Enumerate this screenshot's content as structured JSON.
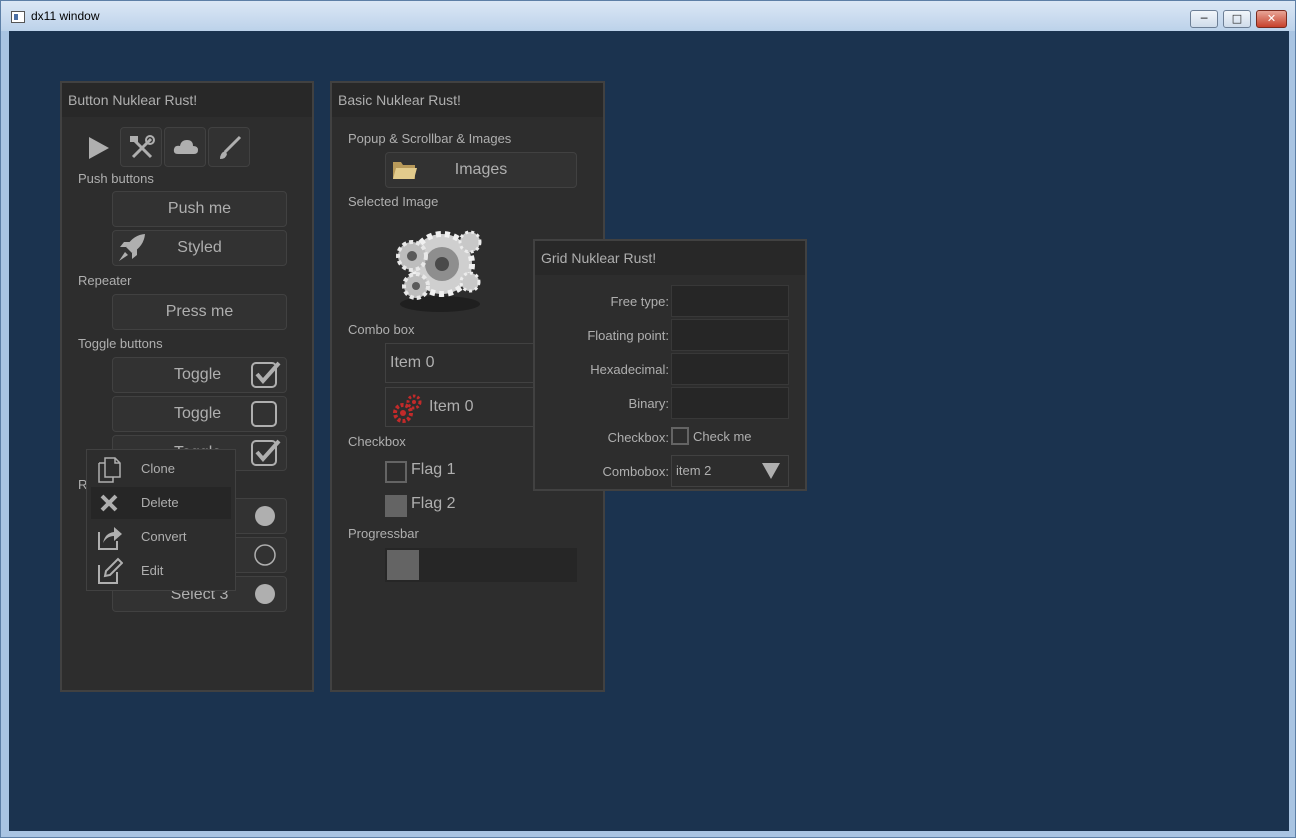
{
  "window": {
    "title": "dx11 window",
    "minimize": "─",
    "maximize": "□",
    "close": "✕"
  },
  "colors": {
    "desktop_bg": "#1b334f",
    "panel_bg": "#2d2d2d",
    "panel_header": "#282828",
    "text": "#afafaf",
    "gear_red": "#c22a2a"
  },
  "button_panel": {
    "title": "Button Nuklear Rust!",
    "icons": [
      "play-icon",
      "tools-icon",
      "cloud-icon",
      "brush-icon"
    ],
    "push_label": "Push buttons",
    "push_me": "Push me",
    "styled": "Styled",
    "repeater_label": "Repeater",
    "press_me": "Press me",
    "toggle_label": "Toggle buttons",
    "toggles": [
      {
        "label": "Toggle",
        "checked": true
      },
      {
        "label": "Toggle",
        "checked": false
      },
      {
        "label": "Toggle",
        "checked": true
      }
    ],
    "radio_label_partial": "R",
    "select_3": "Select 3"
  },
  "context_menu": {
    "items": [
      {
        "label": "Clone",
        "icon": "clone-icon"
      },
      {
        "label": "Delete",
        "icon": "delete-icon",
        "hovered": true
      },
      {
        "label": "Convert",
        "icon": "convert-icon"
      },
      {
        "label": "Edit",
        "icon": "edit-icon"
      }
    ]
  },
  "basic_panel": {
    "title": "Basic Nuklear Rust!",
    "popup_label": "Popup & Scrollbar & Images",
    "images_button": "Images",
    "selected_label": "Selected Image",
    "combo_label": "Combo box",
    "combo1": "Item 0",
    "combo2": "Item 0",
    "checkbox_label": "Checkbox",
    "flag1": "Flag 1",
    "flag2": "Flag 2",
    "progress_label": "Progressbar",
    "progress_fraction": 0.17
  },
  "grid_panel": {
    "title": "Grid Nuklear Rust!",
    "free_type": "Free type:",
    "floating_point": "Floating point:",
    "hexadecimal": "Hexadecimal:",
    "binary": "Binary:",
    "checkbox": "Checkbox:",
    "check_me": "Check me",
    "combobox": "Combobox:",
    "combo_value": "item 2"
  }
}
